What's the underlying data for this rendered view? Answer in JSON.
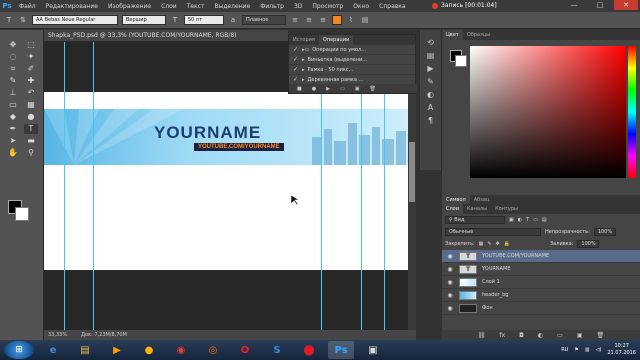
{
  "menubar": {
    "logo": "Ps",
    "items": [
      "Файл",
      "Редактирование",
      "Изображение",
      "Слои",
      "Текст",
      "Выделение",
      "Фильтр",
      "3D",
      "Просмотр",
      "Окно",
      "Справка"
    ],
    "recording_label": "Запись [00:01:04]",
    "window_controls": [
      "—",
      "□",
      "✕"
    ]
  },
  "options_bar": {
    "font_family": "AA Bebas Neue Regular",
    "font_style": "Вершир",
    "font_size": "50 пт",
    "antialias": "Плавное"
  },
  "document": {
    "tab_title": "Shapka_PSD.psd @ 33,3% (YOUTUBE.COM/YOURNAME, RGB/8)",
    "banner_title": "YOURNAME",
    "banner_url": "YOUTUBE.COM/YOURNAME"
  },
  "status_bar": {
    "zoom": "33,33%",
    "doc_size": "Док: 7,23M/8,70M"
  },
  "actions_panel": {
    "tabs": [
      "История",
      "Операции"
    ],
    "rows": [
      {
        "label": "Операции по умол..."
      },
      {
        "label": "Виньетка (выделени..."
      },
      {
        "label": "Рамка - 50 пикс..."
      },
      {
        "label": "Деревянная рамка ..."
      }
    ]
  },
  "color_panel": {
    "tabs": [
      "Цвет",
      "Образцы"
    ]
  },
  "char_tabs": [
    "Символ",
    "Абзац"
  ],
  "layers_panel": {
    "tabs": [
      "Слои",
      "Каналы",
      "Контуры"
    ],
    "filter_label": "Вид",
    "blend_mode": "Обычные",
    "opacity_label": "Непрозрачность:",
    "opacity_value": "100%",
    "lock_label": "Закрепить:",
    "fill_label": "Заливка:",
    "fill_value": "100%",
    "layers": [
      {
        "name": "YOUTUBE.COM/YOURNAME",
        "thumb": "T",
        "selected": true
      },
      {
        "name": "YOURNAME",
        "thumb": "T",
        "selected": false
      },
      {
        "name": "Слой 1",
        "thumb": "",
        "selected": false
      },
      {
        "name": "header_bg",
        "thumb": "",
        "selected": false
      },
      {
        "name": "Фон",
        "thumb": "",
        "selected": false
      }
    ]
  },
  "taskbar": {
    "language": "RU",
    "time": "10:27",
    "date": "21.07.2016"
  }
}
